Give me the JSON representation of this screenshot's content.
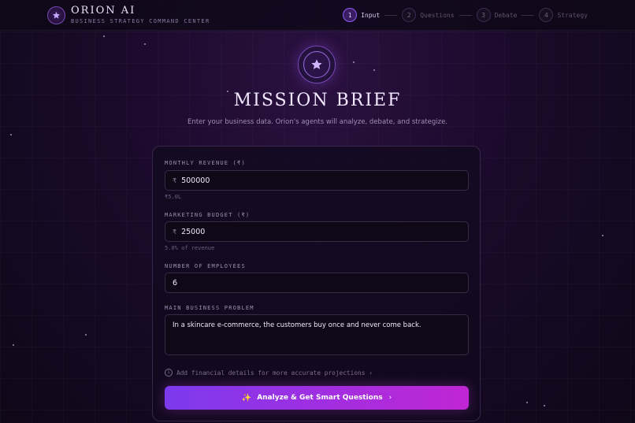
{
  "brand": {
    "title": "ORION AI",
    "subtitle": "BUSINESS STRATEGY COMMAND CENTER",
    "logo_icon": "star-icon"
  },
  "steps": [
    {
      "num": "1",
      "label": "Input",
      "active": true
    },
    {
      "num": "2",
      "label": "Questions",
      "active": false
    },
    {
      "num": "3",
      "label": "Debate",
      "active": false
    },
    {
      "num": "4",
      "label": "Strategy",
      "active": false
    }
  ],
  "hero": {
    "icon": "star-icon",
    "title": "MISSION BRIEF",
    "subtitle": "Enter your business data. Orion's agents will analyze, debate, and strategize."
  },
  "form": {
    "revenue": {
      "label": "MONTHLY REVENUE (₹)",
      "prefix": "₹",
      "value": "500000",
      "hint": "₹5.0L"
    },
    "marketing": {
      "label": "MARKETING BUDGET (₹)",
      "prefix": "₹",
      "value": "25000",
      "hint": "5.0% of revenue"
    },
    "employees": {
      "label": "NUMBER OF EMPLOYEES",
      "value": "6"
    },
    "problem": {
      "label": "MAIN BUSINESS PROBLEM",
      "value": "In a skincare e-commerce, the customers buy once and never come back."
    },
    "financial_link": "Add financial details for more accurate projections",
    "submit_label": "Analyze & Get Smart Questions"
  },
  "colors": {
    "accent": "#8b5cf6",
    "cta_start": "#7c3aed",
    "cta_end": "#c026d3",
    "background": "#1a0a2a"
  }
}
